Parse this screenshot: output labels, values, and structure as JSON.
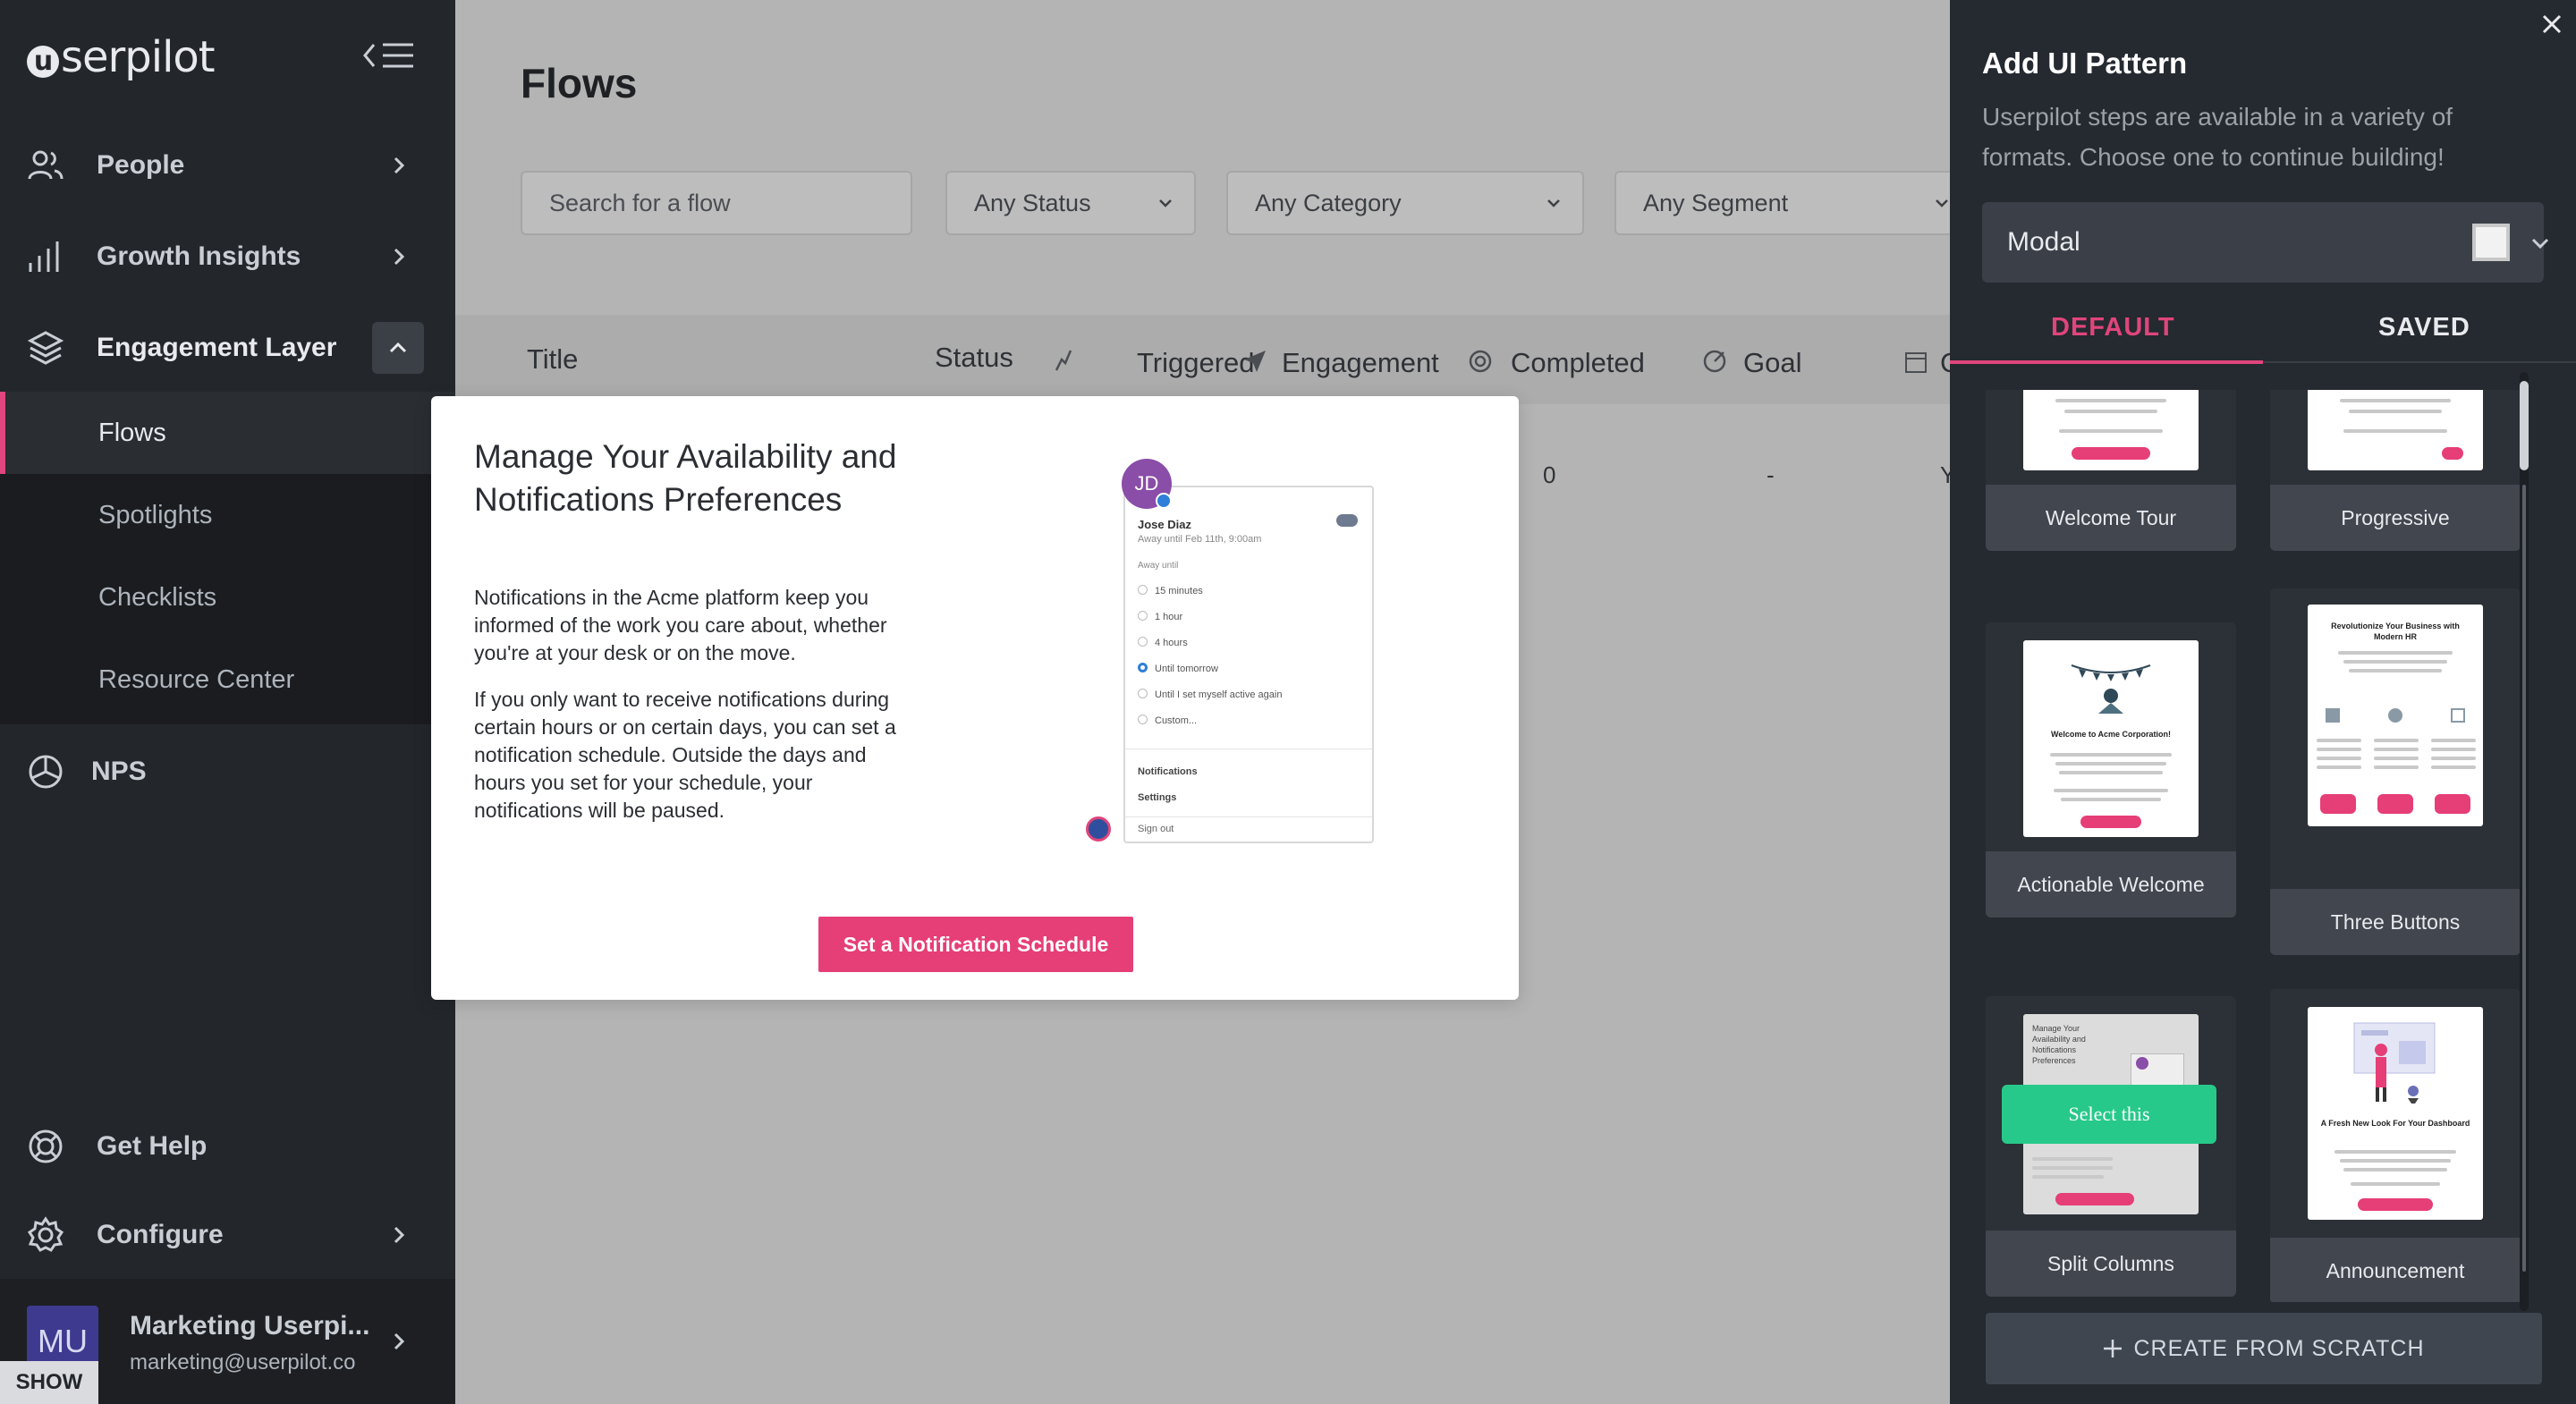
{
  "sidebar": {
    "logo": "serpilot",
    "logo_mark": "u",
    "items": [
      {
        "label": "People",
        "icon": "people-icon"
      },
      {
        "label": "Growth Insights",
        "icon": "bar-chart-icon"
      },
      {
        "label": "Engagement Layer",
        "icon": "layers-icon"
      },
      {
        "label": "NPS",
        "icon": "pie-chart-icon"
      },
      {
        "label": "Get Help",
        "icon": "lifebuoy-icon"
      },
      {
        "label": "Configure",
        "icon": "gear-icon"
      }
    ],
    "subitems": [
      "Flows",
      "Spotlights",
      "Checklists",
      "Resource Center"
    ],
    "user": {
      "initials": "MU",
      "name": "Marketing Userpi...",
      "email": "marketing@userpilot.co"
    },
    "show_label": "SHOW"
  },
  "main": {
    "title": "Flows",
    "search_placeholder": "Search for a flow",
    "filters": [
      "Any Status",
      "Any Category",
      "Any Segment"
    ],
    "columns": [
      "Title",
      "Status",
      "Triggered",
      "Engagement",
      "Completed",
      "Goal",
      "C"
    ],
    "row": {
      "completed": "0",
      "goal": "-",
      "c": "Y"
    }
  },
  "modal_preview": {
    "title": "Manage Your Availability and Notifications Preferences",
    "p1": "Notifications in the Acme platform keep you informed of the work you care about, whether you're at your desk or on the move.",
    "p2": "If you only want to receive notifications during certain hours or on certain days, you can set a notification schedule. Outside the days and hours you set for your schedule, your notifications will be paused.",
    "button": "Set a Notification Schedule",
    "illustration": {
      "initials": "JD",
      "name": "Jose Diaz",
      "status": "Away until Feb 11th, 9:00am",
      "away_label": "Away until",
      "options": [
        "15 minutes",
        "1 hour",
        "4 hours",
        "Until tomorrow",
        "Until I set myself active again",
        "Custom..."
      ],
      "menu": [
        "Notifications",
        "Settings"
      ],
      "signout": "Sign out"
    }
  },
  "panel": {
    "title": "Add UI Pattern",
    "description": "Userpilot steps are available in a variety of formats. Choose one to continue building!",
    "selected_type": "Modal",
    "tabs": [
      "DEFAULT",
      "SAVED"
    ],
    "active_tab": "DEFAULT",
    "cards": [
      "Welcome Tour",
      "Progressive",
      "Actionable Welcome",
      "Three Buttons",
      "Split Columns",
      "Announcement"
    ],
    "thumbs": {
      "welcome_heading": "Welcome to Acme Corporation!",
      "three_heading": "Revolutionize Your Business with Modern HR",
      "announce_heading": "A Fresh New Look For Your Dashboard",
      "split_heading": "Manage Your Availability and Notifications Preferences"
    },
    "hover_button": "Select this",
    "create_button": "CREATE FROM SCRATCH"
  },
  "colors": {
    "accent": "#e0457b",
    "button_pink": "#e63e76",
    "select_green": "#27c98a",
    "sidebar_bg": "#23262b",
    "panel_bg": "#252930"
  }
}
